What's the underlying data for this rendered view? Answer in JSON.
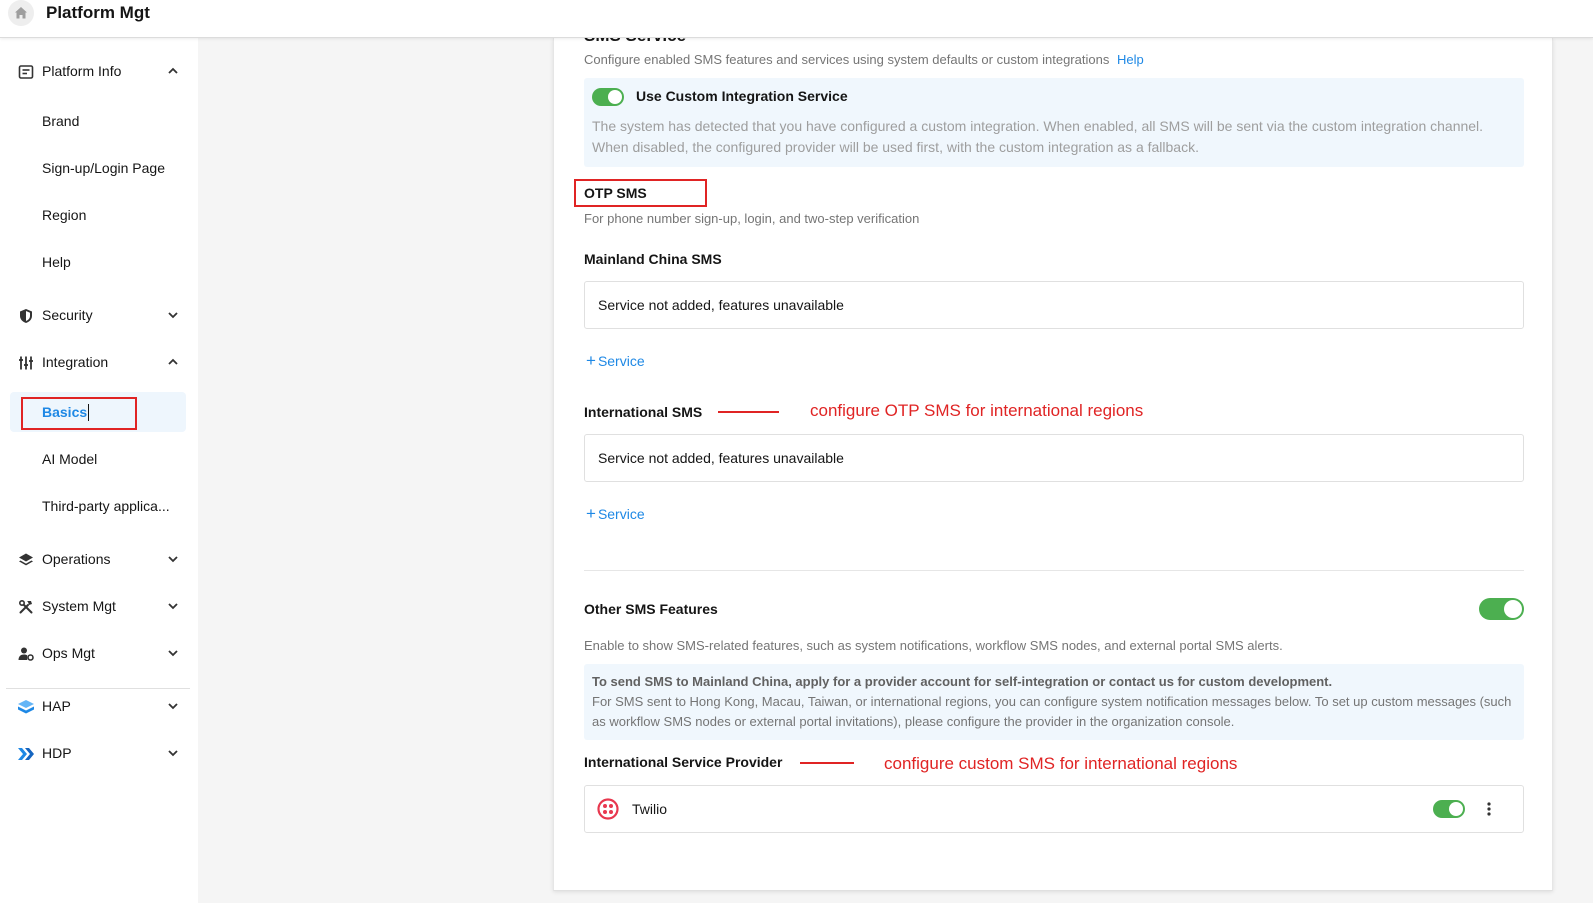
{
  "header": {
    "title": "Platform Mgt",
    "home_icon": "home-icon"
  },
  "sidebar": {
    "groups": [
      {
        "label": "Platform Info",
        "icon": "info-card-icon",
        "expanded": true,
        "items": [
          "Brand",
          "Sign-up/Login Page",
          "Region",
          "Help"
        ]
      },
      {
        "label": "Security",
        "icon": "shield-icon",
        "expanded": false
      },
      {
        "label": "Integration",
        "icon": "sliders-icon",
        "expanded": true,
        "items": [
          "Basics",
          "AI Model",
          "Third-party applica..."
        ]
      },
      {
        "label": "Operations",
        "icon": "layers-icon",
        "expanded": false
      },
      {
        "label": "System Mgt",
        "icon": "tools-icon",
        "expanded": false
      },
      {
        "label": "Ops Mgt",
        "icon": "user-gear-icon",
        "expanded": false
      },
      {
        "label": "HAP",
        "icon": "hap-logo-icon",
        "expanded": false
      },
      {
        "label": "HDP",
        "icon": "hdp-logo-icon",
        "expanded": false
      }
    ],
    "active_item": "Basics"
  },
  "main": {
    "section_title": "SMS Service",
    "section_desc": "Configure enabled SMS features and services using system defaults or custom integrations",
    "help_link": "Help",
    "custom_integration": {
      "label": "Use Custom Integration Service",
      "enabled": true,
      "desc": "The system has detected that you have configured a custom integration. When enabled, all SMS will be sent via the custom integration channel. When disabled, the configured provider will be used first, with the custom integration as a fallback."
    },
    "otp": {
      "title": "OTP SMS",
      "desc": "For phone number sign-up, login, and two-step verification",
      "mainland_title": "Mainland China SMS",
      "mainland_status": "Service not added, features unavailable",
      "add_service": "Service",
      "intl_title": "International SMS",
      "intl_status": "Service not added, features unavailable"
    },
    "other": {
      "title": "Other SMS Features",
      "enabled": true,
      "desc": "Enable to show SMS-related features, such as system notifications, workflow SMS nodes, and external portal SMS alerts.",
      "note_bold": "To send SMS to Mainland China, apply for a provider account for self-integration or contact us for custom development.",
      "note_text": "For SMS sent to Hong Kong, Macau, Taiwan, or international regions, you can configure system notification messages below. To set up custom messages (such as workflow SMS nodes or external portal invitations), please configure the provider in the organization console.",
      "provider_title": "International Service Provider",
      "provider_name": "Twilio",
      "provider_enabled": true
    }
  },
  "annotations": {
    "otp_intl": "configure OTP SMS for international regions",
    "custom_intl": "configure custom SMS for international regions",
    "color": "#e02424"
  },
  "colors": {
    "accent": "#1e88e5",
    "toggle_on": "#4caf50",
    "twilio": "#e8384f"
  }
}
